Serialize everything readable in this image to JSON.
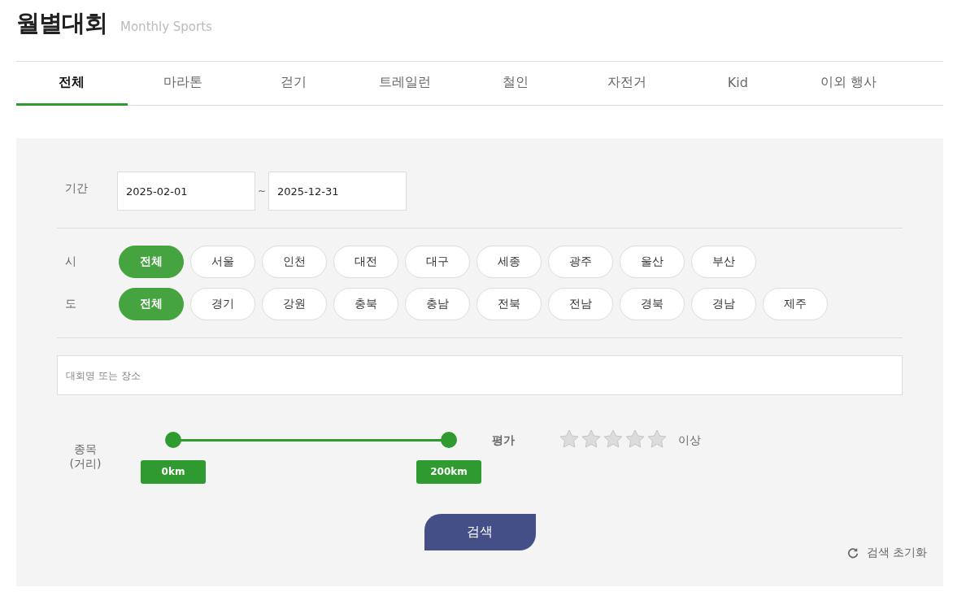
{
  "header": {
    "title": "월별대회",
    "subtitle": "Monthly Sports"
  },
  "tabs": [
    {
      "label": "전체",
      "selected": true
    },
    {
      "label": "마라톤",
      "selected": false
    },
    {
      "label": "걷기",
      "selected": false
    },
    {
      "label": "트레일런",
      "selected": false
    },
    {
      "label": "철인",
      "selected": false
    },
    {
      "label": "자전거",
      "selected": false
    },
    {
      "label": "Kid",
      "selected": false
    },
    {
      "label": "이외 행사",
      "selected": false
    }
  ],
  "period": {
    "label": "기간",
    "start": "2025-02-01",
    "separator": "~",
    "end": "2025-12-31"
  },
  "regions": [
    {
      "label": "시",
      "chips": [
        {
          "label": "전체",
          "selected": true
        },
        {
          "label": "서울",
          "selected": false
        },
        {
          "label": "인천",
          "selected": false
        },
        {
          "label": "대전",
          "selected": false
        },
        {
          "label": "대구",
          "selected": false
        },
        {
          "label": "세종",
          "selected": false
        },
        {
          "label": "광주",
          "selected": false
        },
        {
          "label": "울산",
          "selected": false
        },
        {
          "label": "부산",
          "selected": false
        }
      ]
    },
    {
      "label": "도",
      "chips": [
        {
          "label": "전체",
          "selected": true
        },
        {
          "label": "경기",
          "selected": false
        },
        {
          "label": "강원",
          "selected": false
        },
        {
          "label": "충북",
          "selected": false
        },
        {
          "label": "충남",
          "selected": false
        },
        {
          "label": "전북",
          "selected": false
        },
        {
          "label": "전남",
          "selected": false
        },
        {
          "label": "경북",
          "selected": false
        },
        {
          "label": "경남",
          "selected": false
        },
        {
          "label": "제주",
          "selected": false
        }
      ]
    }
  ],
  "search_field": {
    "placeholder": "대회명 또는 장소"
  },
  "distance": {
    "label": "종목",
    "sublabel": "(거리)",
    "low": {
      "level": 0,
      "reading": "0km"
    },
    "high": {
      "level": 1,
      "reading": "200km"
    }
  },
  "rating": {
    "label": "평가",
    "stars": 0,
    "suffix": "이상"
  },
  "search_button": "검색",
  "reset": "검색 초기화"
}
